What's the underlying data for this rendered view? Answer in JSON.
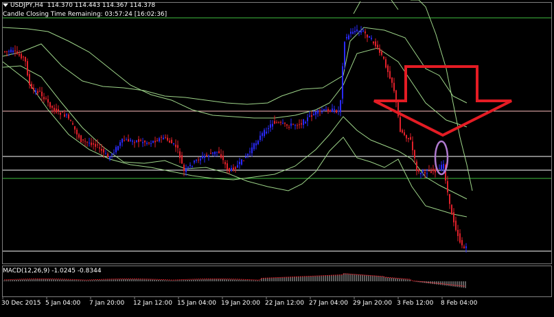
{
  "header": {
    "symbol": "USDJPY,H4",
    "ohlc": "114.370 114.443 114.367 114.378",
    "timer": "Candle Closing Time Remaining: 03:57:24 [16:02:36]"
  },
  "macd": {
    "label": "MACD(12,26,9) -1.0245 -0.8344",
    "fast": 12,
    "slow": 26,
    "signal_period": 9,
    "main": -1.0245,
    "signal": -0.8344
  },
  "colors": {
    "background": "#000000",
    "bull_candle": "#2a2aff",
    "bear_candle": "#e0202a",
    "bands": "#9fd68a",
    "level_white": "#ffffff",
    "level_green": "#3fbf3f",
    "level_pink": "#ffc0c0",
    "arrow": "#e41c24",
    "ellipse": "#b07ad0",
    "macd_bar": "#c0c0c0",
    "macd_signal": "#e0202a"
  },
  "chart_data": {
    "type": "candlestick",
    "symbol": "USDJPY",
    "timeframe": "H4",
    "x_ticks": [
      "30 Dec 2015",
      "5 Jan 04:00",
      "7 Jan 20:00",
      "12 Jan 12:00",
      "15 Jan 04:00",
      "19 Jan 20:00",
      "22 Jan 12:00",
      "27 Jan 04:00",
      "29 Jan 20:00",
      "3 Feb 12:00",
      "8 Feb 04:00"
    ],
    "last_bar": {
      "open": 114.37,
      "high": 114.443,
      "low": 114.367,
      "close": 114.378
    },
    "indicators": [
      "Bollinger Bands (two sets)",
      "MACD(12,26,9)"
    ],
    "annotations": [
      "large red downward arrow",
      "purple ellipse around candle near 8 Feb"
    ]
  }
}
